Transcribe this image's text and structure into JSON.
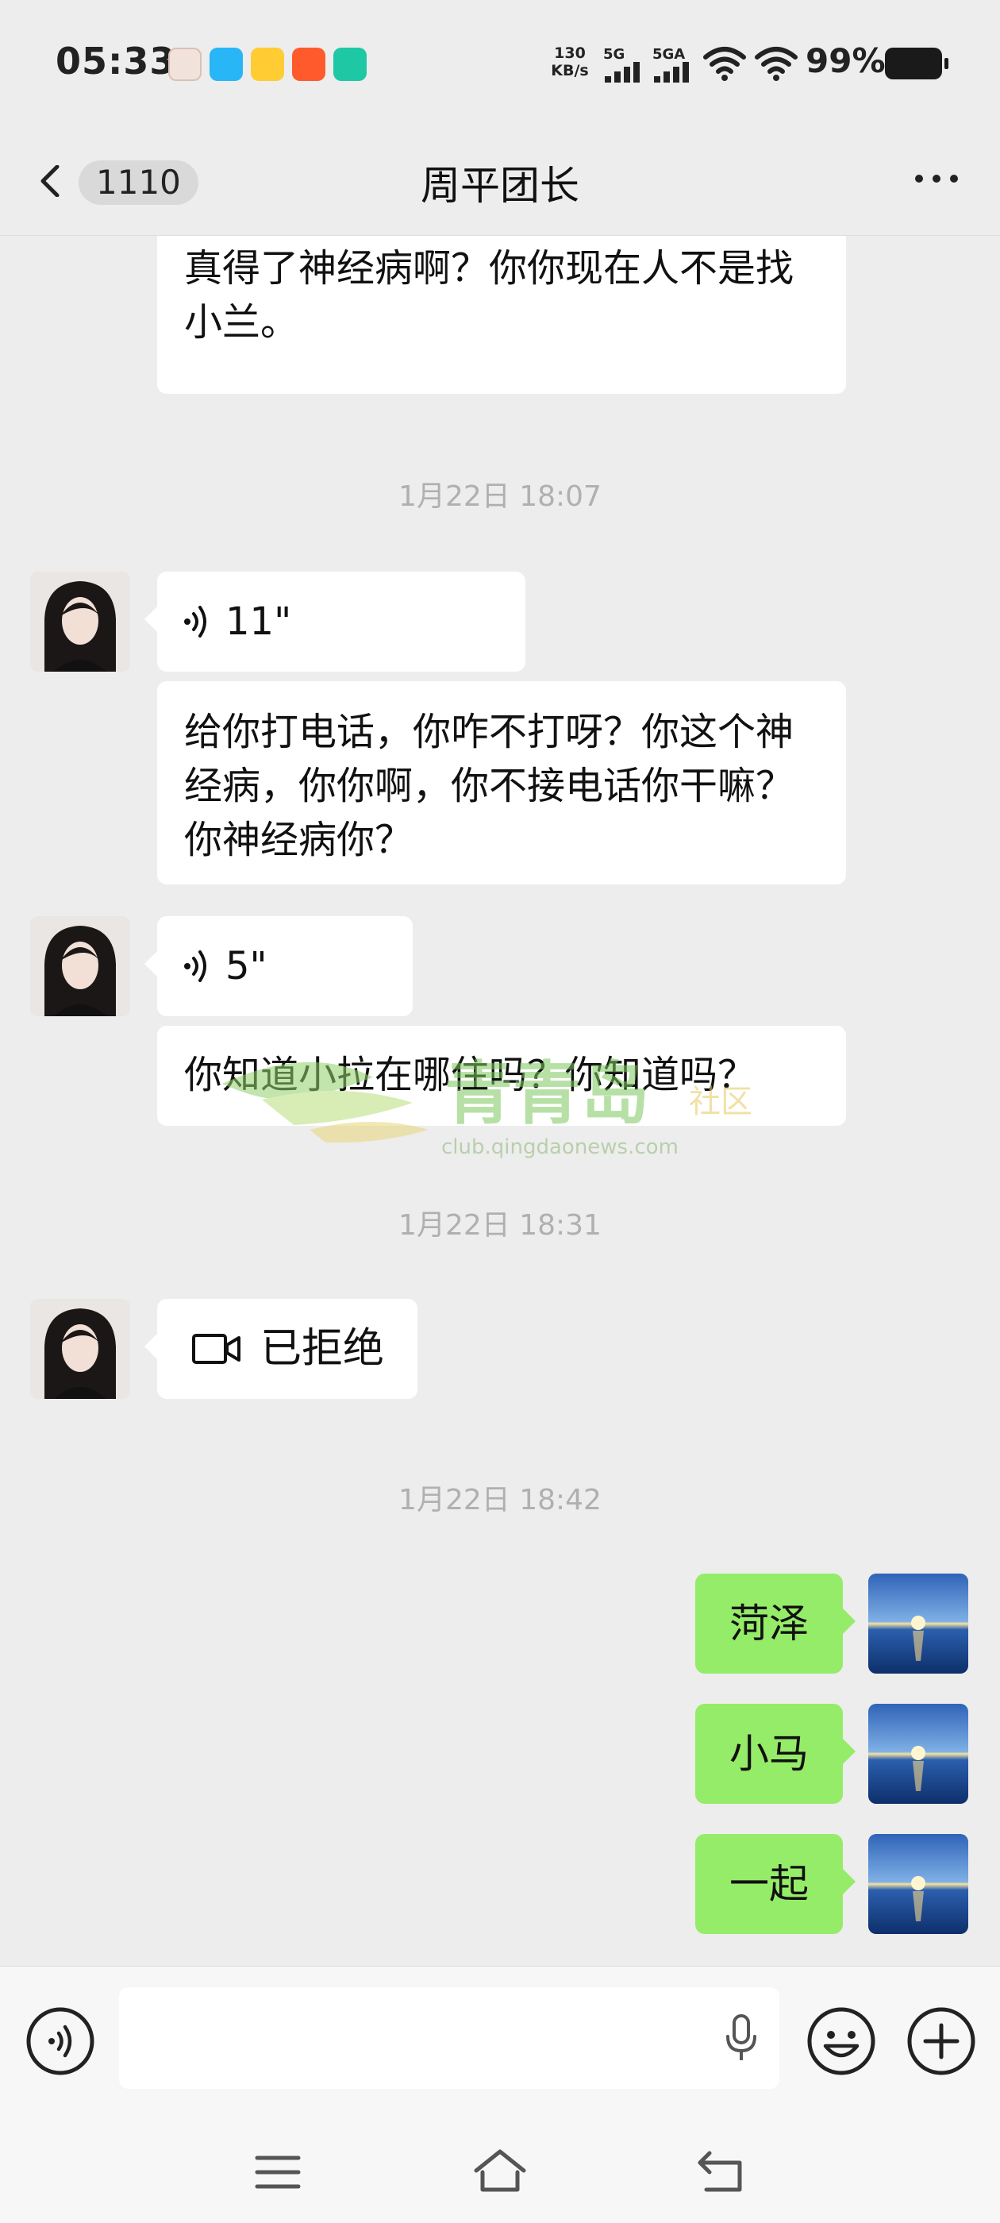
{
  "status_bar": {
    "time": "05:33",
    "net_speed_value": "130",
    "net_speed_unit": "KB/s",
    "signal1_label": "5G",
    "signal2_label": "5GA",
    "battery_percent": "99%",
    "notification_icons": [
      "avatar-app-icon",
      "qq-icon",
      "cartoon-app-icon",
      "grid-app-icon",
      "green-app-icon"
    ]
  },
  "header": {
    "back_count": "1110",
    "title": "周平团长",
    "more_icon": "more-dots-icon"
  },
  "messages": {
    "m0_text": "么？你找小兰？你找周平干什么？你真得了神经病啊？你你现在人不是找小兰。",
    "ts1": "1月22日 18:07",
    "m1_voice_duration": "11\"",
    "m2_text": "给你打电话，你咋不打呀？你这个神经病，你你啊，你不接电话你干嘛？你神经病你？",
    "m3_voice_duration": "5\"",
    "m4_text": "你知道小拉在哪住吗？你知道吗？",
    "ts2": "1月22日 18:31",
    "m5_call_status": "已拒绝",
    "ts3": "1月22日 18:42",
    "m6_text": "菏泽",
    "m7_text": "小马",
    "m8_text": "一起"
  },
  "watermark": {
    "logo_text": "青青岛",
    "tag": "社区",
    "url": "club.qingdaonews.com"
  },
  "input_bar": {
    "voice_toggle_icon": "voice-toggle-icon",
    "mic_icon": "microphone-icon",
    "emoji_icon": "emoji-icon",
    "plus_icon": "plus-icon"
  },
  "system_nav": {
    "icons": [
      "menu-icon",
      "home-icon",
      "back-icon"
    ]
  },
  "colors": {
    "background": "#ededed",
    "bubble_other": "#ffffff",
    "bubble_self": "#95ec69",
    "timestamp": "#b0b0b0"
  }
}
